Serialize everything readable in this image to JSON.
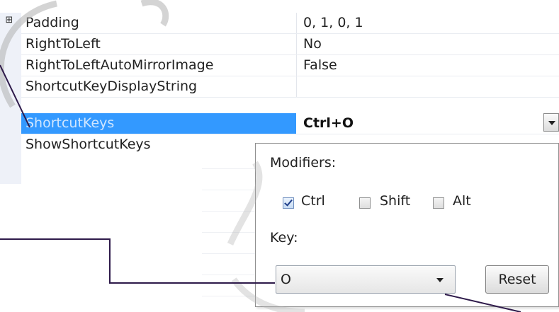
{
  "properties": [
    {
      "name": "Padding",
      "value": "0, 1, 0, 1",
      "expandable": true
    },
    {
      "name": "RightToLeft",
      "value": "No"
    },
    {
      "name": "RightToLeftAutoMirrorImage",
      "value": "False"
    },
    {
      "name": "ShortcutKeyDisplayString",
      "value": ""
    },
    {
      "name": "ShortcutKeys",
      "value": "Ctrl+O",
      "selected": true
    },
    {
      "name": "ShowShortcutKeys",
      "value": ""
    }
  ],
  "expander_symbol": "⊞",
  "editor": {
    "modifiers_label": "Modifiers:",
    "modifiers": [
      {
        "label": "Ctrl",
        "checked": true
      },
      {
        "label": "Shift",
        "checked": false
      },
      {
        "label": "Alt",
        "checked": false
      }
    ],
    "key_label": "Key:",
    "key_value": "O",
    "reset_label": "Reset"
  },
  "colors": {
    "selection": "#3399ff",
    "callout_line": "#2e1a4a",
    "callout_circle": "#b0b0b0"
  }
}
